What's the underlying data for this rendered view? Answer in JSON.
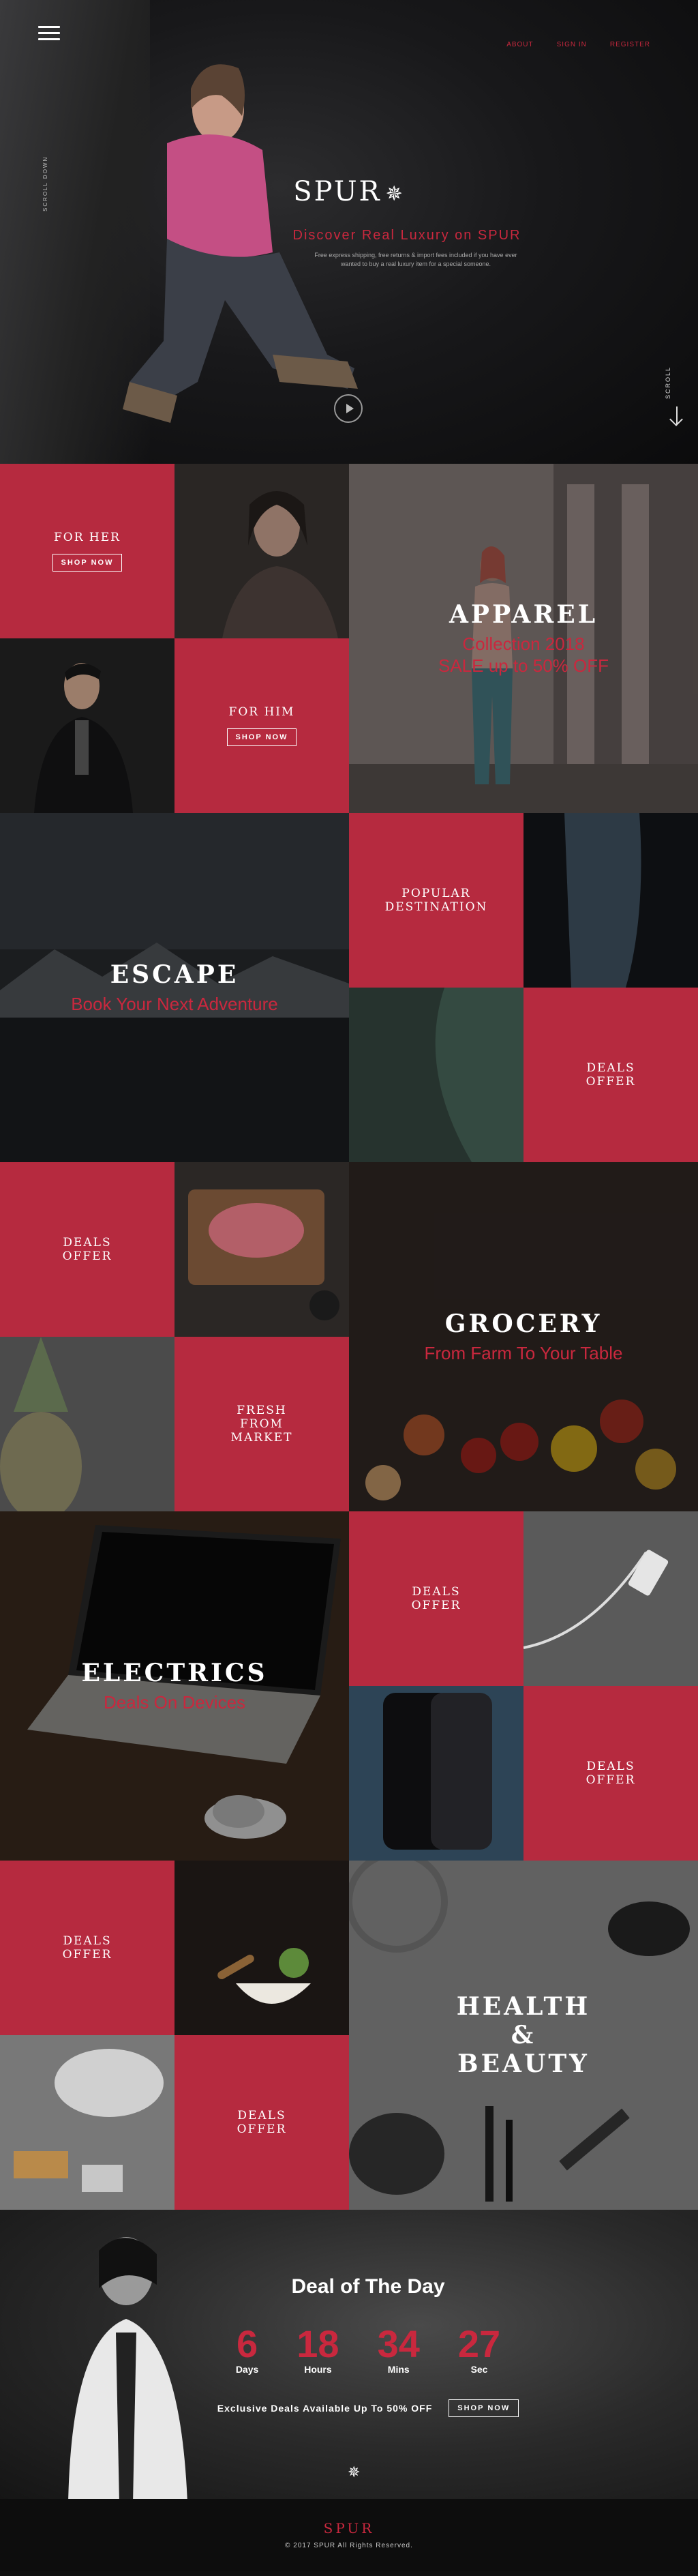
{
  "nav": {
    "about": "ABOUT",
    "signin": "SIGN IN",
    "register": "REGISTER"
  },
  "hero": {
    "logo": "SPUR",
    "logo_mark": "✵",
    "side_text": "SCROLL DOWN",
    "tagline": "Discover Real Luxury on SPUR",
    "description": "Free express shipping, free returns & import fees included if you have ever wanted to buy a real luxury item for a special someone.",
    "scroll_label": "SCROLL"
  },
  "sections": {
    "for_her": {
      "title": "FOR HER",
      "button": "SHOP NOW"
    },
    "for_him": {
      "title": "FOR HIM",
      "button": "SHOP NOW"
    },
    "apparel": {
      "title": "APPAREL",
      "sub1": "Collection 2018",
      "sub2": "SALE up to 50% OFF"
    },
    "escape": {
      "title": "ESCAPE",
      "sub": "Book Your Next Adventure"
    },
    "popular": {
      "title": "POPULAR DESTINATION"
    },
    "deals": "DEALS OFFER",
    "grocery": {
      "title": "GROCERY",
      "sub": "From Farm To Your Table"
    },
    "fresh": {
      "title": "FRESH FROM MARKET"
    },
    "electrics": {
      "title": "ELECTRICS",
      "sub": "Deals On Devices"
    },
    "health": {
      "title1": "HEALTH",
      "title2": "&",
      "title3": "BEAUTY"
    }
  },
  "deal_of_day": {
    "title": "Deal of The Day",
    "counters": [
      {
        "value": "6",
        "unit": "Days"
      },
      {
        "value": "18",
        "unit": "Hours"
      },
      {
        "value": "34",
        "unit": "Mins"
      },
      {
        "value": "27",
        "unit": "Sec"
      }
    ],
    "text": "Exclusive Deals Available Up To 50% OFF",
    "button": "SHOP NOW"
  },
  "footer": {
    "logo": "SPUR",
    "copyright": "© 2017 SPUR All Rights Reserved."
  },
  "colors": {
    "accent": "#c9283e",
    "tile_red": "#b62a3f"
  }
}
